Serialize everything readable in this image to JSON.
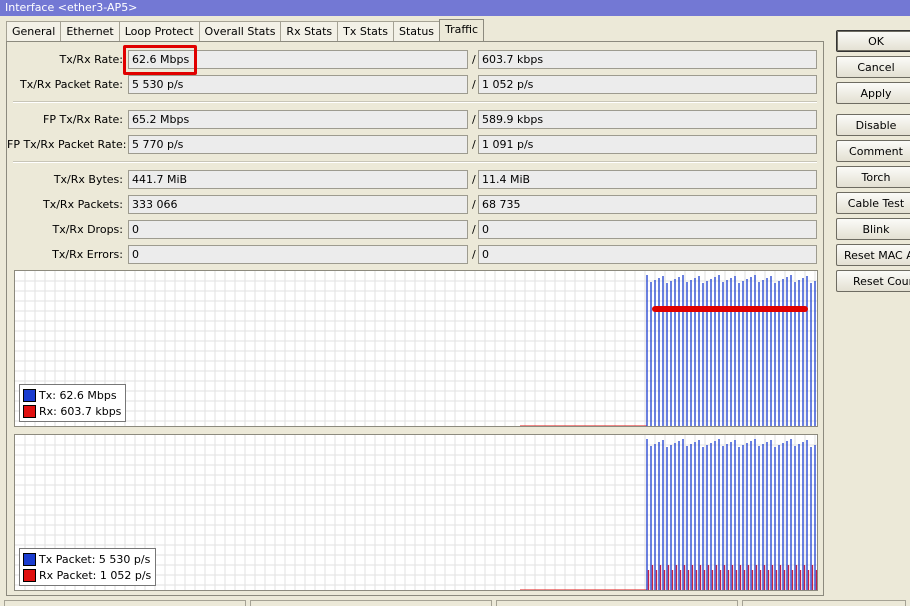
{
  "window": {
    "title": "Interface <ether3-AP5>"
  },
  "tabs": [
    {
      "label": "General"
    },
    {
      "label": "Ethernet"
    },
    {
      "label": "Loop Protect"
    },
    {
      "label": "Overall Stats"
    },
    {
      "label": "Rx Stats"
    },
    {
      "label": "Tx Stats"
    },
    {
      "label": "Status"
    },
    {
      "label": "Traffic",
      "active": true
    }
  ],
  "fields": {
    "tx_rx_rate": {
      "label": "Tx/Rx Rate:",
      "tx": "62.6 Mbps",
      "rx": "603.7 kbps"
    },
    "tx_rx_packet_rate": {
      "label": "Tx/Rx Packet Rate:",
      "tx": "5 530 p/s",
      "rx": "1 052 p/s"
    },
    "fp_tx_rx_rate": {
      "label": "FP Tx/Rx Rate:",
      "tx": "65.2 Mbps",
      "rx": "589.9 kbps"
    },
    "fp_tx_rx_packet_rate": {
      "label": "FP Tx/Rx Packet Rate:",
      "tx": "5 770 p/s",
      "rx": "1 091 p/s"
    },
    "tx_rx_bytes": {
      "label": "Tx/Rx Bytes:",
      "tx": "441.7 MiB",
      "rx": "11.4 MiB"
    },
    "tx_rx_packets": {
      "label": "Tx/Rx Packets:",
      "tx": "333 066",
      "rx": "68 735"
    },
    "tx_rx_drops": {
      "label": "Tx/Rx Drops:",
      "tx": "0",
      "rx": "0"
    },
    "tx_rx_errors": {
      "label": "Tx/Rx Errors:",
      "tx": "0",
      "rx": "0"
    },
    "separator": "/"
  },
  "graphs": {
    "traffic": {
      "legend": [
        {
          "name": "Tx:",
          "value": "62.6 Mbps",
          "color": "#1a3ccf"
        },
        {
          "name": "Rx:",
          "value": "603.7 kbps",
          "color": "#e01010"
        }
      ]
    },
    "packets": {
      "legend": [
        {
          "name": "Tx Packet:",
          "value": "5 530 p/s",
          "color": "#1a3ccf"
        },
        {
          "name": "Rx Packet:",
          "value": "1 052 p/s",
          "color": "#e01010"
        }
      ]
    }
  },
  "buttons": {
    "ok": "OK",
    "cancel": "Cancel",
    "apply": "Apply",
    "disable": "Disable",
    "comment": "Comment",
    "torch": "Torch",
    "cable_test": "Cable Test",
    "blink": "Blink",
    "reset_mac": "Reset MAC Address",
    "reset_counters": "Reset Counters"
  },
  "colors": {
    "title_bar": "#7378d4",
    "tx": "#1a3ccf",
    "rx": "#e01010",
    "annotation": "#e00000"
  }
}
